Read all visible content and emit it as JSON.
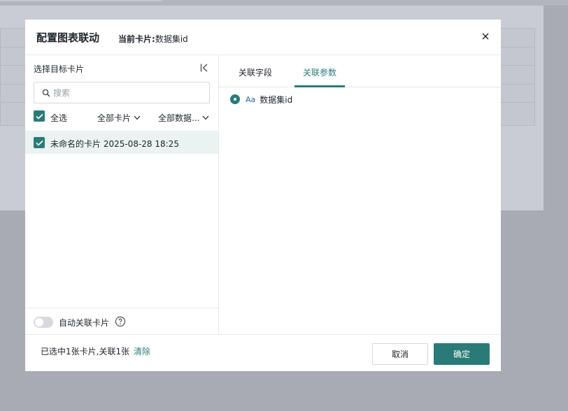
{
  "dialog": {
    "title": "配置图表联动",
    "subtitle_label": "当前卡片:",
    "subtitle_value": "数据集id"
  },
  "left_panel": {
    "title": "选择目标卡片",
    "search_placeholder": "搜索",
    "select_all_label": "全选",
    "filter_cards_label": "全部卡片",
    "filter_datasets_label": "全部数据...",
    "cards": [
      {
        "label": "未命名的卡片 2025-08-28 18:25",
        "checked": true
      }
    ],
    "auto_link_label": "自动关联卡片",
    "auto_link_enabled": false
  },
  "right_panel": {
    "tabs": [
      {
        "label": "关联字段",
        "active": false
      },
      {
        "label": "关联参数",
        "active": true
      }
    ],
    "params": [
      {
        "type_icon": "Aa",
        "label": "数据集id",
        "selected": true
      }
    ]
  },
  "footer": {
    "summary": "已选中1张卡片,关联1张",
    "clear_label": "清除",
    "cancel_label": "取消",
    "ok_label": "确定"
  },
  "colors": {
    "accent": "#2a7b78",
    "overlay": "#a8abb3"
  }
}
